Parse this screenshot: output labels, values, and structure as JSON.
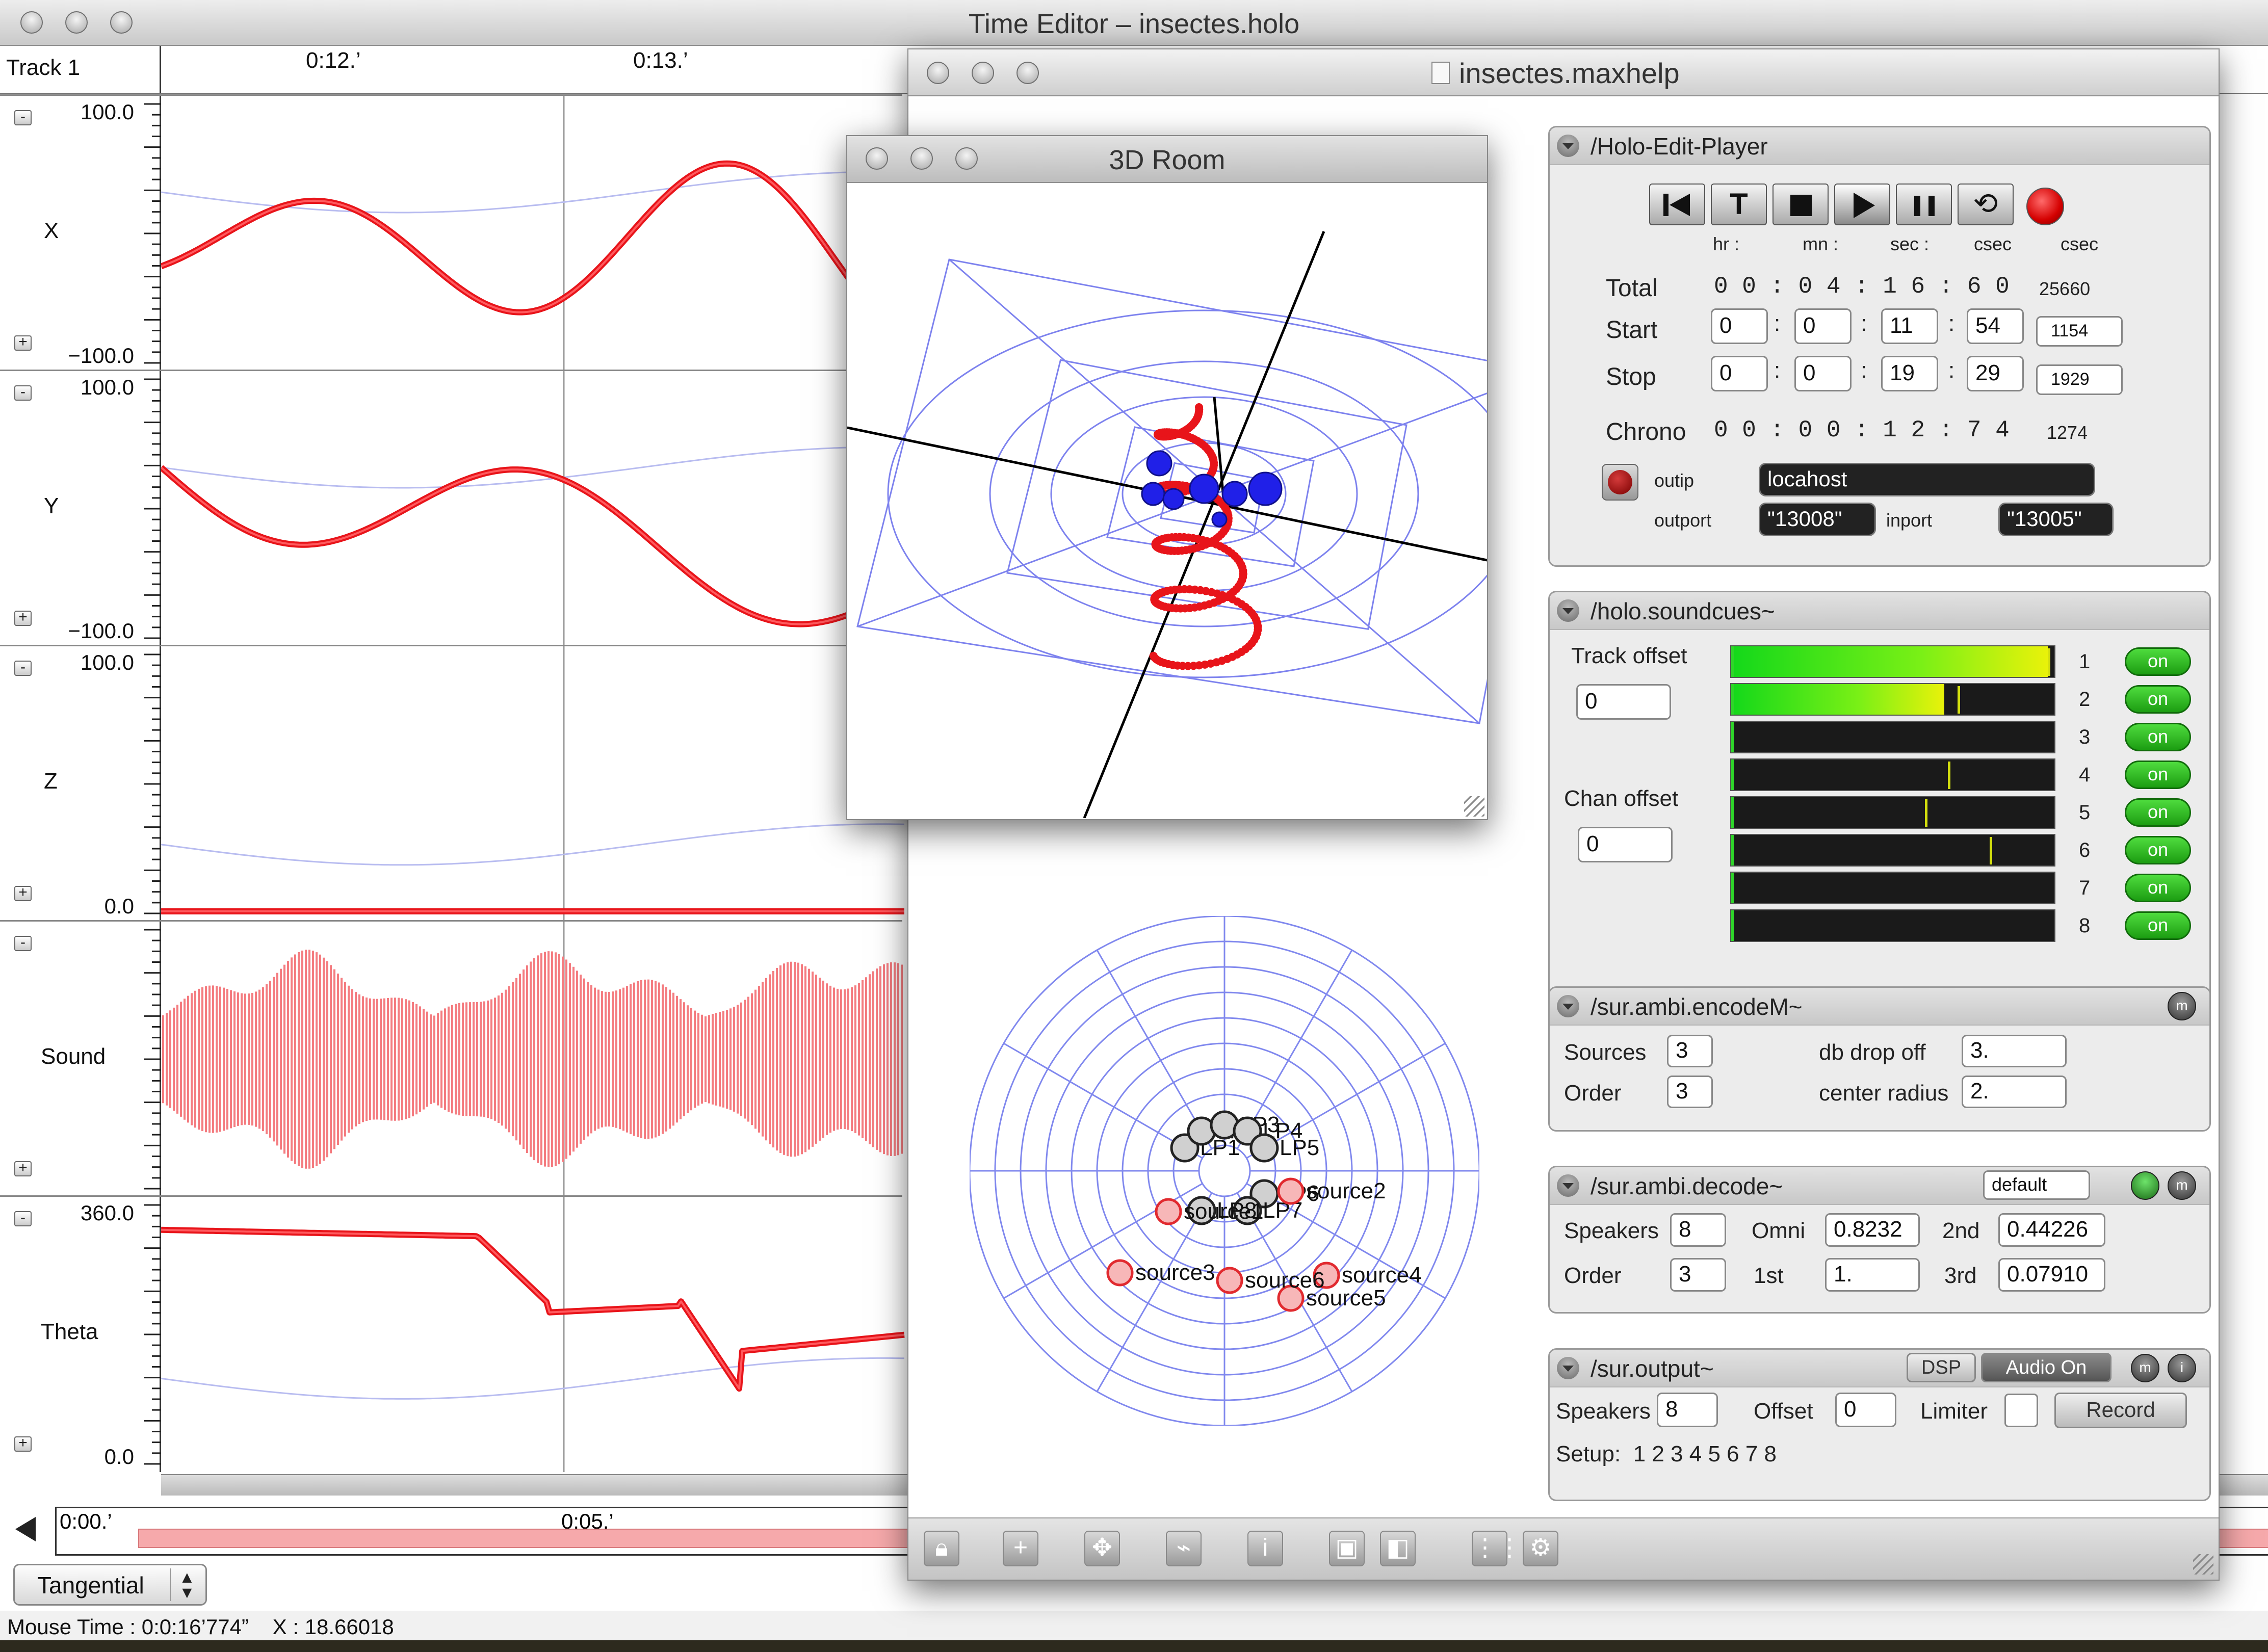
{
  "time_editor": {
    "title": "Time Editor – insectes.holo",
    "track_label": "Track 1",
    "timeline_marks": [
      "0:12.’",
      "0:13.’"
    ],
    "tracks": [
      {
        "name": "X",
        "max": "100.0",
        "min": "−100.0"
      },
      {
        "name": "Y",
        "max": "100.0",
        "min": "−100.0"
      },
      {
        "name": "Z",
        "max": "100.0",
        "min": "0.0"
      },
      {
        "name": "Sound",
        "max": "",
        "min": ""
      },
      {
        "name": "Theta",
        "max": "360.0",
        "min": "0.0"
      }
    ],
    "overview_marks": [
      "0:00.’",
      "0:05.’"
    ],
    "curve_mode": "Tangential",
    "status": "Mouse Time : 0:0:16’774”    X : 18.66018",
    "colors": {
      "curve": "#e8141a",
      "sound": "#f47c80",
      "guide": "#b8bcf0"
    }
  },
  "maxhelp": {
    "title": "insectes.maxhelp",
    "room": {
      "title": "3D Room"
    },
    "speaker_map": {
      "speakers": [
        "LP1",
        "LP2",
        "LP3",
        "LP4",
        "LP5",
        "LP6",
        "LP7",
        "LP8"
      ],
      "sources": [
        "source1",
        "source2",
        "source3",
        "source4",
        "source5",
        "source6"
      ]
    },
    "player": {
      "title": "/Holo-Edit-Player",
      "col_labels": [
        "hr :",
        "mn :",
        "sec :",
        "csec",
        "csec"
      ],
      "total_label": "Total",
      "total_value": "0 0 : 0 4 : 1 6 : 6 0",
      "total_csec": "25660",
      "start_label": "Start",
      "start": [
        "0",
        "0",
        "11",
        "54"
      ],
      "start_csec": "1154",
      "stop_label": "Stop",
      "stop": [
        "0",
        "0",
        "19",
        "29"
      ],
      "stop_csec": "1929",
      "chrono_label": "Chrono",
      "chrono_value": "0 0 : 0 0 : 1 2 : 7 4",
      "chrono_csec": "1274",
      "outip_label": "outip",
      "outip": "locahost",
      "outport_label": "outport",
      "outport": "\"13008\"",
      "inport_label": "inport",
      "inport": "\"13005\""
    },
    "soundcues": {
      "title": "/holo.soundcues~",
      "track_offset_label": "Track offset",
      "track_offset": "0",
      "chan_offset_label": "Chan offset",
      "chan_offset": "0",
      "channels": [
        {
          "num": "1",
          "state": "on",
          "level": 0.98,
          "peak": 0.98
        },
        {
          "num": "2",
          "state": "on",
          "level": 0.66,
          "peak": 0.7
        },
        {
          "num": "3",
          "state": "on",
          "level": 0.0,
          "peak": 0.0
        },
        {
          "num": "4",
          "state": "on",
          "level": 0.0,
          "peak": 0.67
        },
        {
          "num": "5",
          "state": "on",
          "level": 0.0,
          "peak": 0.6
        },
        {
          "num": "6",
          "state": "on",
          "level": 0.0,
          "peak": 0.8
        },
        {
          "num": "7",
          "state": "on",
          "level": 0.0,
          "peak": 0.0
        },
        {
          "num": "8",
          "state": "on",
          "level": 0.0,
          "peak": 0.0
        }
      ]
    },
    "encode": {
      "title": "/sur.ambi.encodeM~",
      "sources_label": "Sources",
      "sources": "3",
      "order_label": "Order",
      "order": "3",
      "dbdrop_label": "db drop off",
      "dbdrop": "3.",
      "radius_label": "center radius",
      "radius": "2."
    },
    "decode": {
      "title": "/sur.ambi.decode~",
      "preset": "default",
      "speakers_label": "Speakers",
      "speakers": "8",
      "omni_label": "Omni",
      "omni": "0.8232",
      "second_label": "2nd",
      "second": "0.44226",
      "order_label": "Order",
      "order": "3",
      "first_label": "1st",
      "first": "1.",
      "third_label": "3rd",
      "third": "0.07910"
    },
    "output": {
      "title": "/sur.output~",
      "dsp": "DSP",
      "audio": "Audio On",
      "speakers_label": "Speakers",
      "speakers": "8",
      "offset_label": "Offset",
      "offset": "0",
      "limiter_label": "Limiter",
      "record": "Record",
      "setup": "Setup:  1 2 3 4 5 6 7 8"
    },
    "small_icon_labels": [
      "m",
      "i"
    ]
  }
}
